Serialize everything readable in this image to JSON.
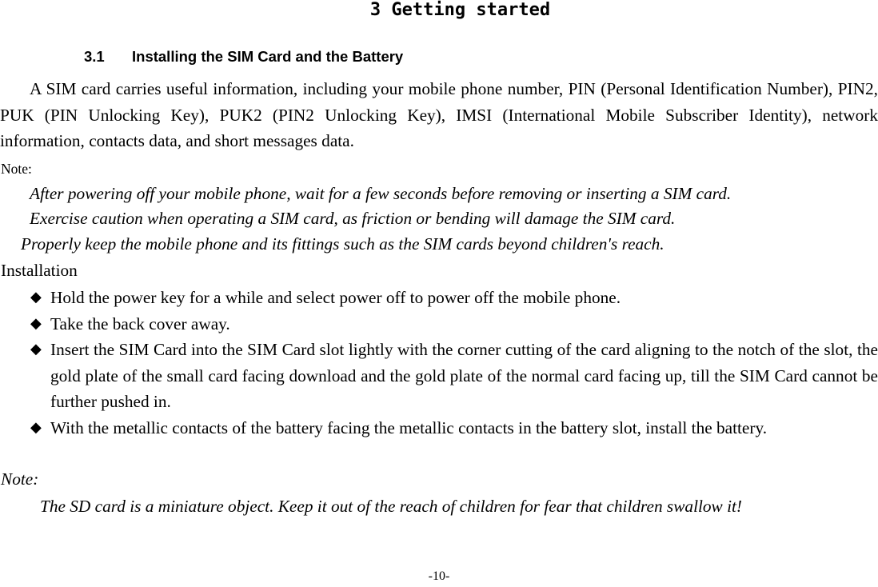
{
  "chapter": {
    "title": "3 Getting started"
  },
  "section": {
    "number": "3.1",
    "title": "Installing the SIM Card and the Battery"
  },
  "intro_paragraph": "A SIM card carries useful information, including your mobile phone number, PIN (Personal Identification Number), PIN2, PUK (PIN Unlocking Key), PUK2 (PIN2 Unlocking Key), IMSI (International Mobile Subscriber Identity), network information, contacts data, and short messages data.",
  "note1": {
    "label": "Note:",
    "items": [
      "After powering off your mobile phone, wait for a few seconds before removing or inserting a SIM card.",
      "Exercise caution when operating a SIM card, as friction or bending will damage the SIM card.",
      "Properly keep the mobile phone and its fittings such as the SIM cards beyond children's reach."
    ]
  },
  "installation": {
    "heading": "Installation",
    "bullet_icon": "diamond-bullet-icon",
    "bullet_glyph": "◆",
    "steps": [
      "Hold the power key for a while and select power off to power off the mobile phone.",
      "Take the back cover away.",
      "Insert the SIM Card into the SIM Card slot lightly with the corner cutting of the card aligning to the notch of the slot, the gold plate of the small card facing download and the gold plate of the normal card facing up, till the SIM Card cannot be further pushed in.",
      "With the metallic contacts of the battery facing the metallic contacts in the battery slot, install the battery."
    ]
  },
  "note2": {
    "label": "Note:",
    "text": "The SD card is a miniature object. Keep it out of the reach of children for fear that children swallow it!"
  },
  "footer": {
    "page_number": "-10-"
  }
}
